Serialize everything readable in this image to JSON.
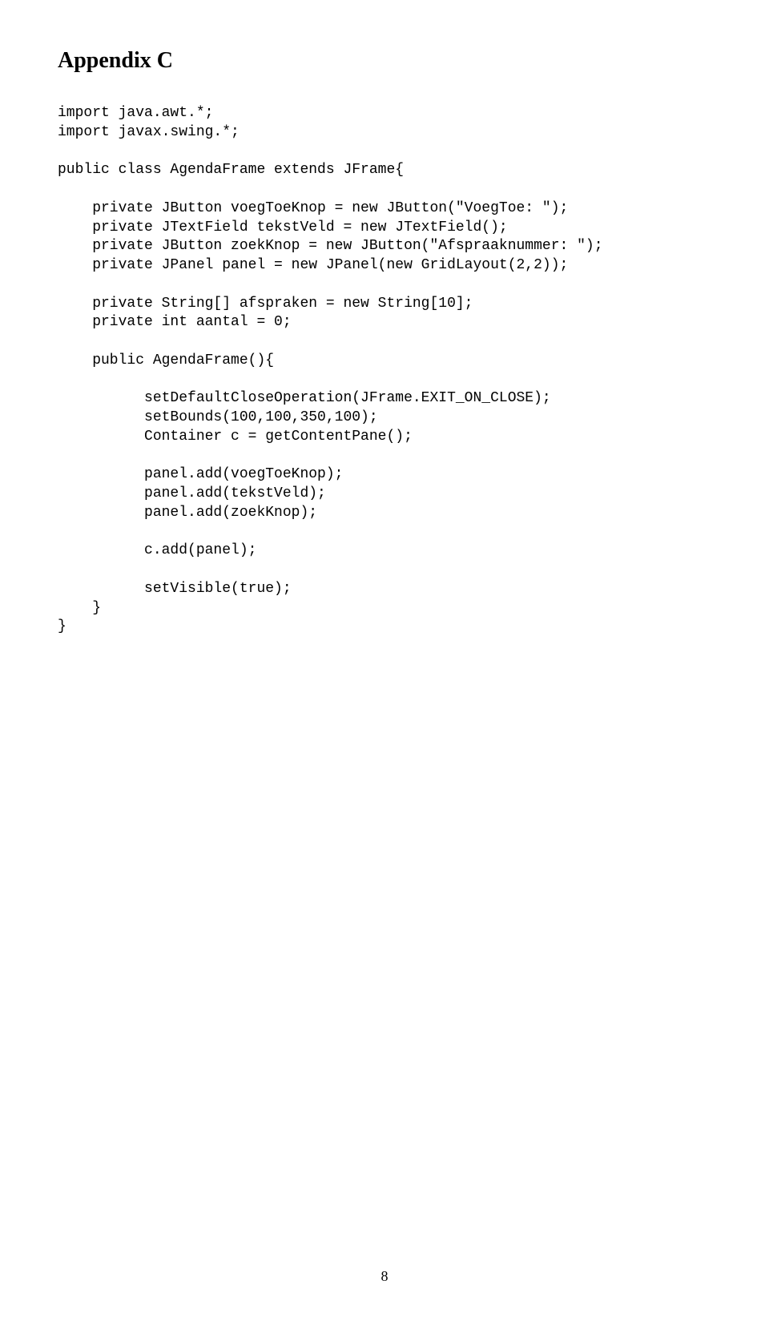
{
  "heading": "Appendix C",
  "code": "import java.awt.*;\nimport javax.swing.*;\n\npublic class AgendaFrame extends JFrame{\n\n    private JButton voegToeKnop = new JButton(\"VoegToe: \");\n    private JTextField tekstVeld = new JTextField();\n    private JButton zoekKnop = new JButton(\"Afspraaknummer: \");\n    private JPanel panel = new JPanel(new GridLayout(2,2));\n\n    private String[] afspraken = new String[10];\n    private int aantal = 0;\n\n    public AgendaFrame(){\n\n          setDefaultCloseOperation(JFrame.EXIT_ON_CLOSE);\n          setBounds(100,100,350,100);\n          Container c = getContentPane();\n\n          panel.add(voegToeKnop);\n          panel.add(tekstVeld);\n          panel.add(zoekKnop);\n\n          c.add(panel);\n\n          setVisible(true);\n    }\n}",
  "pagenum": "8"
}
